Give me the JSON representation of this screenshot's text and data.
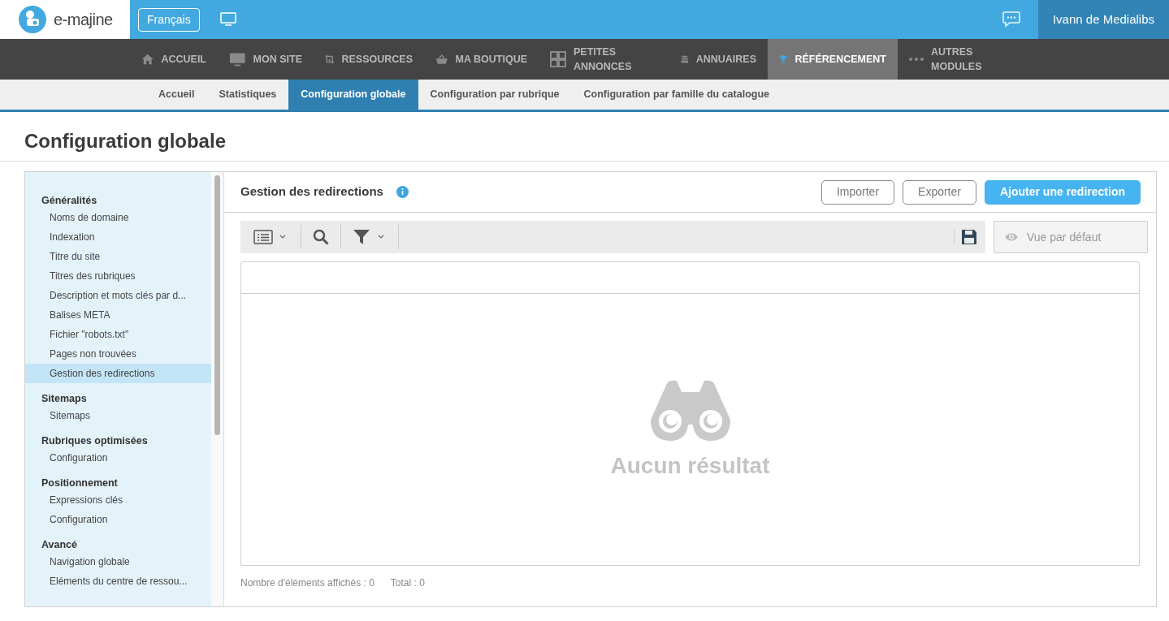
{
  "header": {
    "logo": "e-majine",
    "language_button": "Français",
    "user": "Ivann de Medialibs"
  },
  "nav": [
    {
      "lines": [
        "ACCUEIL"
      ],
      "selected": false
    },
    {
      "lines": [
        "MON SITE"
      ],
      "selected": false
    },
    {
      "lines": [
        "RESSOURCES"
      ],
      "selected": false
    },
    {
      "lines": [
        "MA BOUTIQUE"
      ],
      "selected": false
    },
    {
      "lines": [
        "PETITES",
        "ANNONCES"
      ],
      "selected": false
    },
    {
      "lines": [
        "ANNUAIRES"
      ],
      "selected": false
    },
    {
      "lines": [
        "RÉFÉRENCEMENT"
      ],
      "selected": true
    },
    {
      "lines": [
        "AUTRES",
        "MODULES"
      ],
      "selected": false
    }
  ],
  "tabs": [
    {
      "label": "Accueil",
      "selected": false
    },
    {
      "label": "Statistiques",
      "selected": false
    },
    {
      "label": "Configuration globale",
      "selected": true
    },
    {
      "label": "Configuration par rubrique",
      "selected": false
    },
    {
      "label": "Configuration par famille du catalogue",
      "selected": false
    }
  ],
  "page_title": "Configuration globale",
  "sidebar": {
    "sections": [
      {
        "title": "Généralités",
        "items": [
          {
            "label": "Noms de domaine",
            "selected": false
          },
          {
            "label": "Indexation",
            "selected": false
          },
          {
            "label": "Titre du site",
            "selected": false
          },
          {
            "label": "Titres des rubriques",
            "selected": false
          },
          {
            "label": "Description et mots clés par d...",
            "selected": false
          },
          {
            "label": "Balises META",
            "selected": false
          },
          {
            "label": "Fichier \"robots.txt\"",
            "selected": false
          },
          {
            "label": "Pages non trouvées",
            "selected": false
          },
          {
            "label": "Gestion des redirections",
            "selected": true
          }
        ]
      },
      {
        "title": "Sitemaps",
        "items": [
          {
            "label": "Sitemaps",
            "selected": false
          }
        ]
      },
      {
        "title": "Rubriques optimisées",
        "items": [
          {
            "label": "Configuration",
            "selected": false
          }
        ]
      },
      {
        "title": "Positionnement",
        "items": [
          {
            "label": "Expressions clés",
            "selected": false
          },
          {
            "label": "Configuration",
            "selected": false
          }
        ]
      },
      {
        "title": "Avancé",
        "items": [
          {
            "label": "Navigation globale",
            "selected": false
          },
          {
            "label": "Eléments du centre de ressou...",
            "selected": false
          }
        ]
      }
    ]
  },
  "panel": {
    "title": "Gestion des redirections",
    "buttons": [
      {
        "label": "Importer",
        "kind": "outline"
      },
      {
        "label": "Exporter",
        "kind": "outline"
      },
      {
        "label": "Ajouter une redirection",
        "kind": "primary"
      }
    ],
    "view_select": {
      "placeholder": "Vue par défaut"
    },
    "empty_message": "Aucun résultat",
    "footer": [
      "Nombre d'éléments affichés : 0",
      "Total : 0"
    ]
  }
}
